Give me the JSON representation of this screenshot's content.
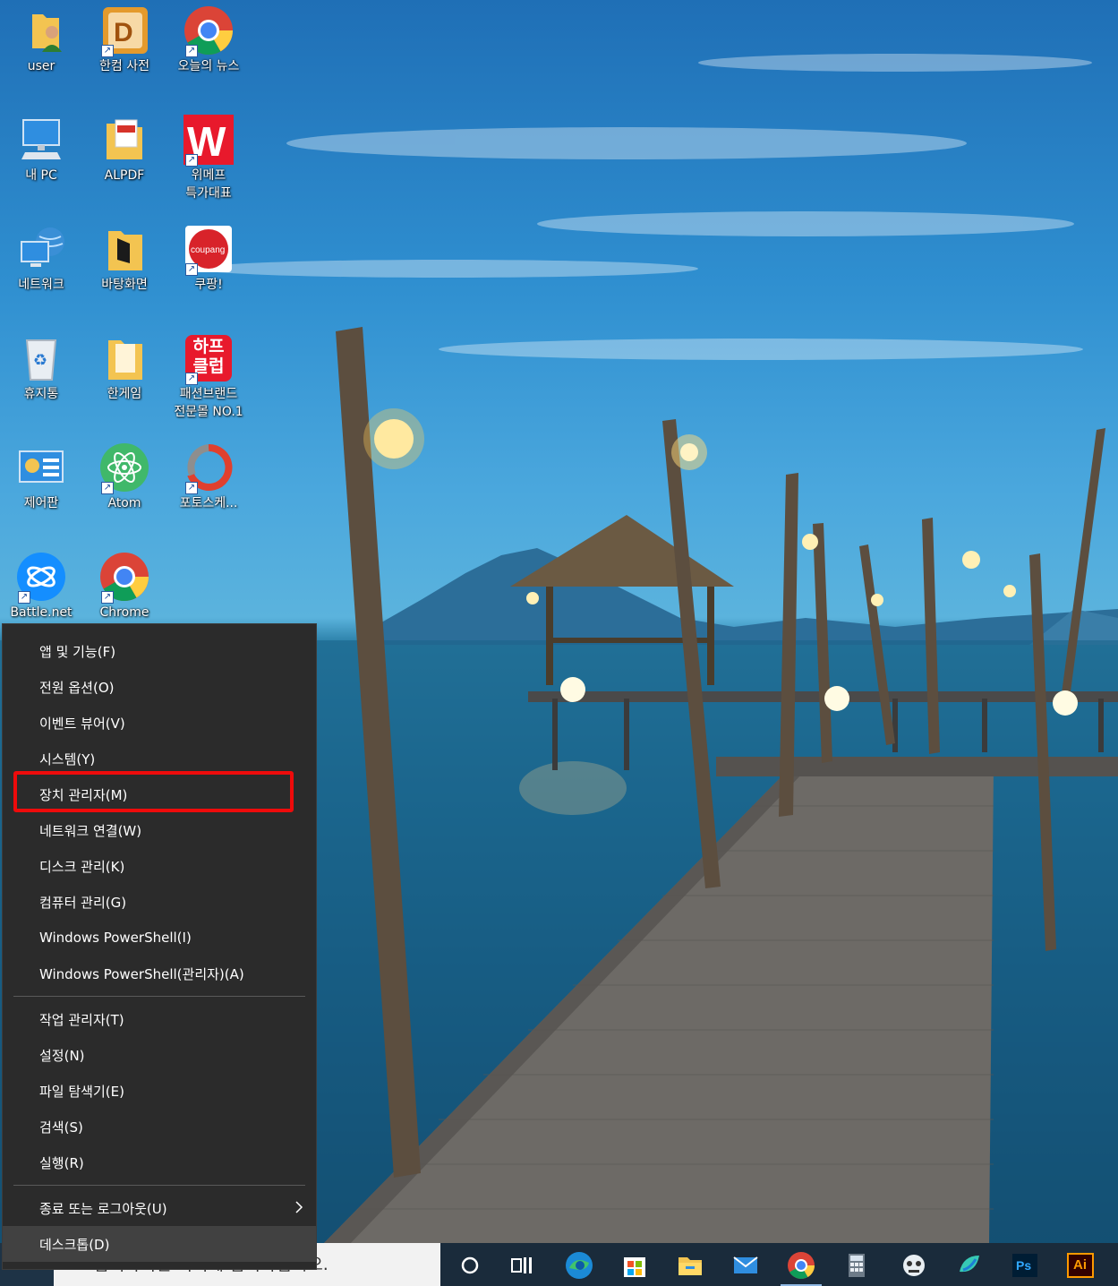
{
  "desktop_icons": [
    {
      "id": "user",
      "label": "user",
      "icon": "user-folder-icon",
      "shortcut": false
    },
    {
      "id": "hancom-dict",
      "label": "한컴 사전",
      "icon": "hancom-dictionary-icon",
      "shortcut": true
    },
    {
      "id": "today-news",
      "label": "오늘의 뉴스",
      "icon": "chrome-icon",
      "shortcut": true
    },
    {
      "id": "my-pc",
      "label": "내 PC",
      "icon": "computer-icon",
      "shortcut": false
    },
    {
      "id": "alpdf",
      "label": "ALPDF",
      "icon": "pdf-folder-icon",
      "shortcut": false
    },
    {
      "id": "wemakeprice",
      "label": "위메프\n특가대표",
      "icon": "wemakeprice-icon",
      "shortcut": true
    },
    {
      "id": "network",
      "label": "네트워크",
      "icon": "network-icon",
      "shortcut": false
    },
    {
      "id": "wallpaper-folder",
      "label": "바탕화면",
      "icon": "folder-icon",
      "shortcut": false
    },
    {
      "id": "coupang",
      "label": "쿠팡!",
      "icon": "coupang-icon",
      "shortcut": true
    },
    {
      "id": "recycle-bin",
      "label": "휴지통",
      "icon": "recycle-bin-icon",
      "shortcut": false
    },
    {
      "id": "hangame",
      "label": "한게임",
      "icon": "folder-icon",
      "shortcut": false
    },
    {
      "id": "halfclub",
      "label": "패션브랜드\n전문몰 NO.1",
      "icon": "halfclub-icon",
      "shortcut": true,
      "badge_text": "하프\n클럽"
    },
    {
      "id": "control-panel",
      "label": "제어판",
      "icon": "control-panel-icon",
      "shortcut": false
    },
    {
      "id": "atom",
      "label": "Atom",
      "icon": "atom-icon",
      "shortcut": true
    },
    {
      "id": "photoscape",
      "label": "포토스케...",
      "icon": "photoscape-icon",
      "shortcut": true
    },
    {
      "id": "battlenet",
      "label": "Battle.net",
      "icon": "battlenet-icon",
      "shortcut": true
    },
    {
      "id": "chrome",
      "label": "Chrome",
      "icon": "chrome-icon",
      "shortcut": true
    }
  ],
  "menu": {
    "group1": [
      {
        "label": "앱 및 기능(F)"
      },
      {
        "label": "전원 옵션(O)"
      },
      {
        "label": "이벤트 뷰어(V)"
      },
      {
        "label": "시스템(Y)"
      },
      {
        "label": "장치 관리자(M)",
        "highlighted": true
      },
      {
        "label": "네트워크 연결(W)"
      },
      {
        "label": "디스크 관리(K)"
      },
      {
        "label": "컴퓨터 관리(G)"
      },
      {
        "label": "Windows PowerShell(I)"
      },
      {
        "label": "Windows PowerShell(관리자)(A)"
      }
    ],
    "group2": [
      {
        "label": "작업 관리자(T)"
      },
      {
        "label": "설정(N)"
      },
      {
        "label": "파일 탐색기(E)"
      },
      {
        "label": "검색(S)"
      },
      {
        "label": "실행(R)"
      }
    ],
    "group3": [
      {
        "label": "종료 또는 로그아웃(U)",
        "submenu": true
      },
      {
        "label": "데스크톱(D)",
        "hover": true
      }
    ]
  },
  "taskbar": {
    "search_text": "검색하려면 여기에 입력하십시오.",
    "apps": [
      "cortana-icon",
      "task-view-icon",
      "edge-icon",
      "store-icon",
      "file-explorer-icon",
      "mail-icon",
      "chrome-icon",
      "calculator-icon",
      "bot-icon",
      "messenger-icon",
      "photoshop-icon",
      "illustrator-icon"
    ],
    "photoshop_label": "Ps",
    "illustrator_label": "Ai"
  },
  "colors": {
    "highlight": "#ee0b0b",
    "menu_bg": "#2b2b2b",
    "taskbar_bg": "#1a2b3b"
  }
}
